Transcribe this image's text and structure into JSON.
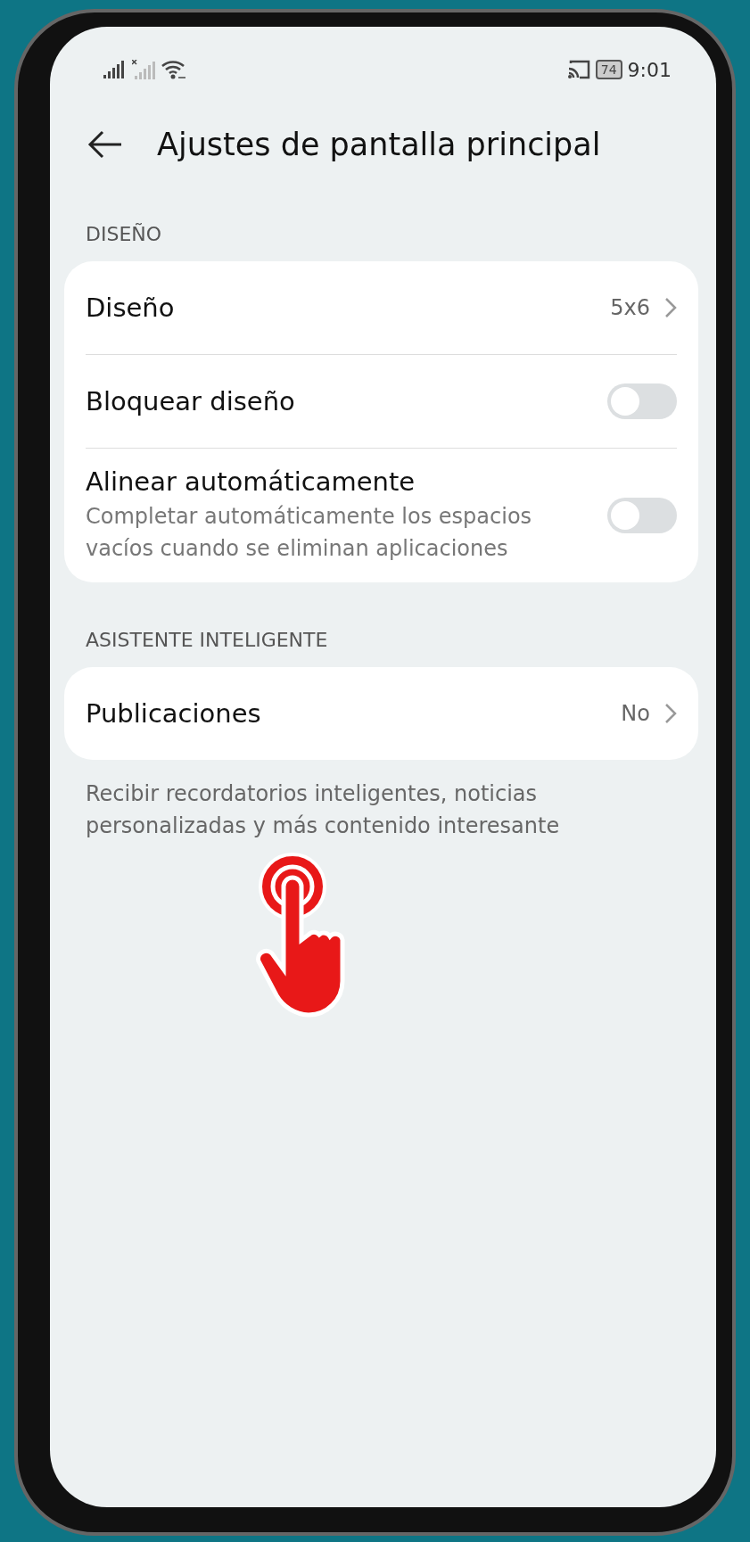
{
  "status_bar": {
    "battery": "74",
    "time": "9:01"
  },
  "header": {
    "title": "Ajustes de pantalla principal"
  },
  "sections": [
    {
      "label": "DISEÑO",
      "rows": [
        {
          "kind": "value",
          "title": "Diseño",
          "value": "5x6"
        },
        {
          "kind": "toggle",
          "title": "Bloquear diseño",
          "on": false
        },
        {
          "kind": "toggle",
          "title": "Alinear automáticamente",
          "subtitle": "Completar automáticamente los espacios vacíos cuando se eliminan aplicaciones",
          "on": false
        }
      ]
    },
    {
      "label": "ASISTENTE INTELIGENTE",
      "rows": [
        {
          "kind": "value",
          "title": "Publicaciones",
          "value": "No"
        }
      ],
      "footer": "Recibir recordatorios inteligentes, noticias personalizadas y más contenido interesante"
    }
  ]
}
